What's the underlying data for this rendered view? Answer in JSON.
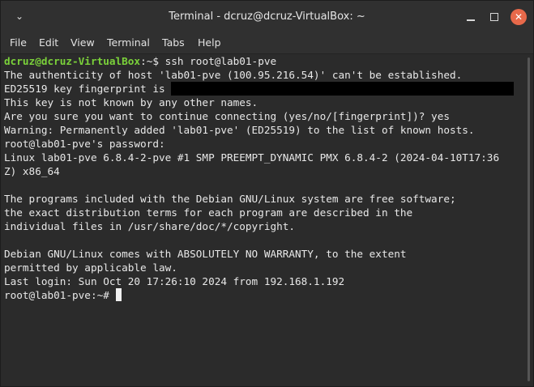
{
  "window": {
    "title": "Terminal - dcruz@dcruz-VirtualBox: ~",
    "menu_icon": "chevron-down-icon",
    "minimize_icon": "minimize-icon",
    "maximize_icon": "maximize-icon",
    "close_icon": "close-icon"
  },
  "menubar": {
    "file": "File",
    "edit": "Edit",
    "view": "View",
    "terminal": "Terminal",
    "tabs": "Tabs",
    "help": "Help"
  },
  "colors": {
    "background": "#2b2b2b",
    "text": "#e8e8e8",
    "prompt_user": "#7bd23a",
    "close_button": "#e7694a"
  },
  "terminal": {
    "l1_user": "dcruz@dcruz-VirtualBox",
    "l1_rest": ":~$ ssh root@lab01-pve",
    "l2": "The authenticity of host 'lab01-pve (100.95.216.54)' can't be established.",
    "l3": "ED25519 key fingerprint is ",
    "l4": "This key is not known by any other names.",
    "l5": "Are you sure you want to continue connecting (yes/no/[fingerprint])? yes",
    "l6": "Warning: Permanently added 'lab01-pve' (ED25519) to the list of known hosts.",
    "l7": "root@lab01-pve's password:",
    "l8": "Linux lab01-pve 6.8.4-2-pve #1 SMP PREEMPT_DYNAMIC PMX 6.8.4-2 (2024-04-10T17:36",
    "l9": "Z) x86_64",
    "l10": "The programs included with the Debian GNU/Linux system are free software;",
    "l11": "the exact distribution terms for each program are described in the",
    "l12": "individual files in /usr/share/doc/*/copyright.",
    "l13": "Debian GNU/Linux comes with ABSOLUTELY NO WARRANTY, to the extent",
    "l14": "permitted by applicable law.",
    "l15": "Last login: Sun Oct 20 17:26:10 2024 from 192.168.1.192",
    "l16": "root@lab01-pve:~# "
  }
}
